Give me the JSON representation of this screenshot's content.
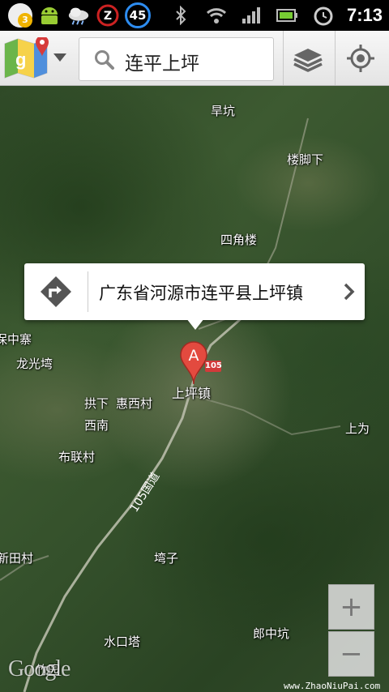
{
  "status_bar": {
    "notification_count": "3",
    "battery_circle_value": "45",
    "time": "7:13"
  },
  "toolbar": {
    "search_value": "连平上坪"
  },
  "map": {
    "places": [
      {
        "name": "旱坑"
      },
      {
        "name": "楼脚下"
      },
      {
        "name": "四角楼"
      },
      {
        "name": "保中寨"
      },
      {
        "name": "龙光塆"
      },
      {
        "name": "上坪镇"
      },
      {
        "name": "拱下"
      },
      {
        "name": "惠西村"
      },
      {
        "name": "西南"
      },
      {
        "name": "上为"
      },
      {
        "name": "布联村"
      },
      {
        "name": "新田村"
      },
      {
        "name": "塆子"
      },
      {
        "name": "郎中坑"
      },
      {
        "name": "水口塔"
      },
      {
        "name": "竹园"
      }
    ],
    "road_label": "105国道",
    "route_badge": "105",
    "marker_label": "A"
  },
  "callout": {
    "address": "广东省河源市连平县上坪镇"
  },
  "zoom": {
    "in_label": "+",
    "out_label": "−"
  },
  "branding": {
    "logo": "Google",
    "watermark": "www.ZhaoNiuPai.com"
  }
}
